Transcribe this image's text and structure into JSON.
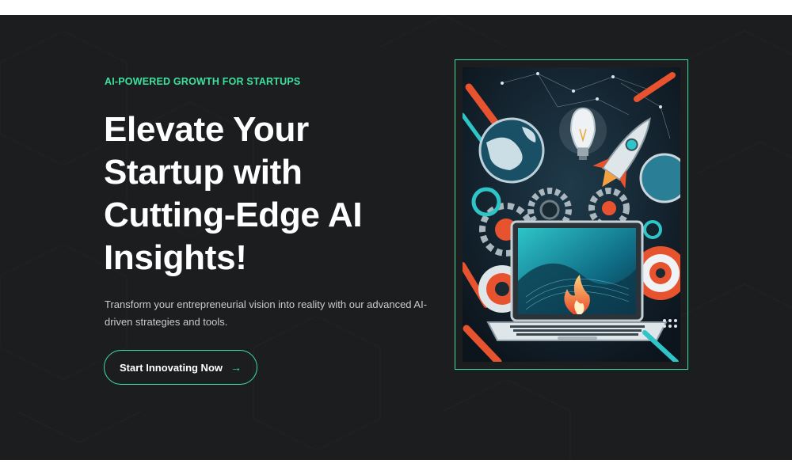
{
  "hero": {
    "eyebrow": "AI-POWERED GROWTH FOR STARTUPS",
    "headline": "Elevate Your Startup with Cutting-Edge AI Insights!",
    "subtext": "Transform your entrepreneurial vision into reality with our advanced AI-driven strategies and tools.",
    "cta_label": "Start Innovating Now",
    "cta_icon": "arrow-right-icon"
  },
  "colors": {
    "accent": "#3ee0a0",
    "background": "#1b1d1f",
    "text": "#ffffff",
    "muted_text": "#c9cbcd"
  },
  "illustration": {
    "description_icon": "ai-startup-illustration",
    "elements": [
      "lightbulb-icon",
      "rocket-icon",
      "globe-icon",
      "gear-icon",
      "laptop-icon",
      "flame-icon"
    ]
  }
}
